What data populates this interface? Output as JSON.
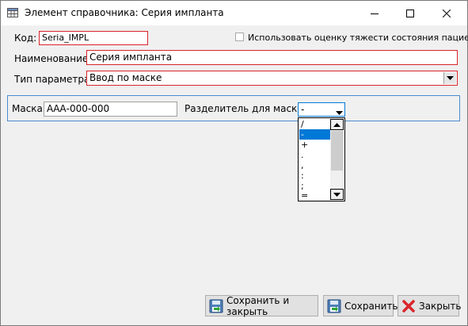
{
  "window": {
    "title": "Элемент справочника: Серия импланта",
    "icon": "table-icon"
  },
  "form": {
    "code_label": "Код:",
    "code_value": "Seria_IMPL",
    "severity_checkbox_label": "Использовать оценку тяжести состояния пациента",
    "severity_checked": false,
    "name_label": "Наименование:",
    "name_value": "Серия импланта",
    "param_type_label": "Тип параметра:",
    "param_type_value": "Ввод по маске"
  },
  "mask": {
    "mask_label": "Маска:",
    "mask_value": "ААА-000-000",
    "separator_label": "Разделитель для маски:",
    "separator_value": "-",
    "options": [
      "/",
      "-",
      "+",
      ".",
      ",",
      ":",
      ";",
      "="
    ],
    "selected_index": 1
  },
  "buttons": {
    "save_close": "Сохранить и закрыть",
    "save": "Сохранить",
    "close": "Закрыть"
  },
  "colors": {
    "required_border": "#d9242b",
    "selection": "#0078d7",
    "panel_border": "#4a8ccf"
  }
}
